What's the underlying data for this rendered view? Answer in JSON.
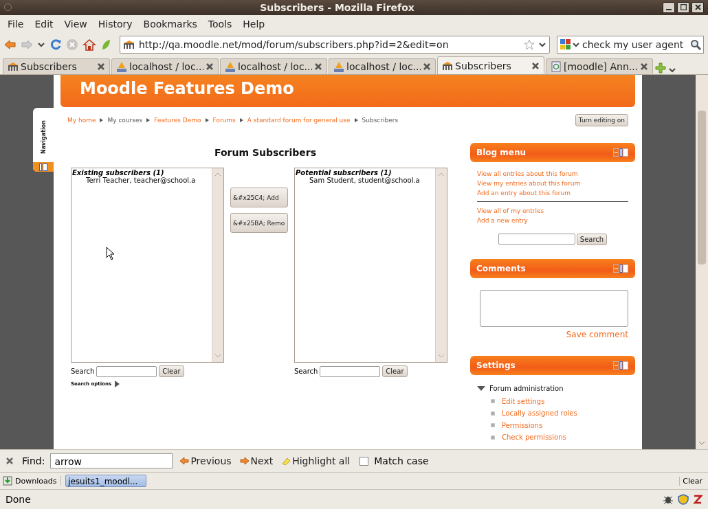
{
  "window": {
    "title": "Subscribers - Mozilla Firefox"
  },
  "menu": [
    "File",
    "Edit",
    "View",
    "History",
    "Bookmarks",
    "Tools",
    "Help"
  ],
  "address": {
    "url": "http://qa.moodle.net/mod/forum/subscribers.php?id=2&edit=on"
  },
  "search": {
    "value": "check my user agent"
  },
  "tabs": [
    {
      "label": "Subscribers",
      "kind": "moodle",
      "selected": false
    },
    {
      "label": "localhost / loc...",
      "kind": "pma",
      "selected": false
    },
    {
      "label": "localhost / loc...",
      "kind": "pma",
      "selected": false
    },
    {
      "label": "localhost / loc...",
      "kind": "pma",
      "selected": false
    },
    {
      "label": "Subscribers",
      "kind": "moodle",
      "selected": true
    },
    {
      "label": "[moodle] Ann...",
      "kind": "page",
      "selected": false
    }
  ],
  "page": {
    "banner_title": "Moodle Features Demo",
    "nav_tab": "Navigation",
    "breadcrumb": [
      {
        "label": "My home",
        "link": true
      },
      {
        "label": "My courses",
        "link": false
      },
      {
        "label": "Features Demo",
        "link": true
      },
      {
        "label": "Forums",
        "link": true
      },
      {
        "label": "A standard forum for general use",
        "link": true
      },
      {
        "label": "Subscribers",
        "link": false
      }
    ],
    "edit_button": "Turn editing on",
    "heading": "Forum Subscribers",
    "existing": {
      "title": "Existing subscribers (1)",
      "items": [
        "Terri Teacher, teacher@school.a"
      ],
      "search_label": "Search",
      "clear": "Clear"
    },
    "potential": {
      "title": "Potential subscribers (1)",
      "items": [
        "Sam Student, student@school.a"
      ],
      "search_label": "Search",
      "clear": "Clear"
    },
    "add_button": "&#x25C4; Add",
    "remove_button": "&#x25BA; Remo",
    "search_options": "Search options",
    "blog_menu": {
      "title": "Blog menu",
      "links": [
        "View all entries about this forum",
        "View my entries about this forum",
        "Add an entry about this forum"
      ],
      "links2": [
        "View all of my entries",
        "Add a new entry"
      ],
      "search_button": "Search"
    },
    "comments": {
      "title": "Comments",
      "save": "Save comment"
    },
    "settings": {
      "title": "Settings",
      "node": "Forum administration",
      "items": [
        "Edit settings",
        "Locally assigned roles",
        "Permissions",
        "Check permissions"
      ]
    }
  },
  "find": {
    "label": "Find:",
    "value": "arrow",
    "previous": "Previous",
    "next": "Next",
    "highlight": "Highlight all",
    "match_case": "Match case",
    "match_case_checked": false
  },
  "downloads": {
    "label": "Downloads",
    "item": "jesuits1_moodl...",
    "clear": "Clear"
  },
  "status_bar": "Done"
}
